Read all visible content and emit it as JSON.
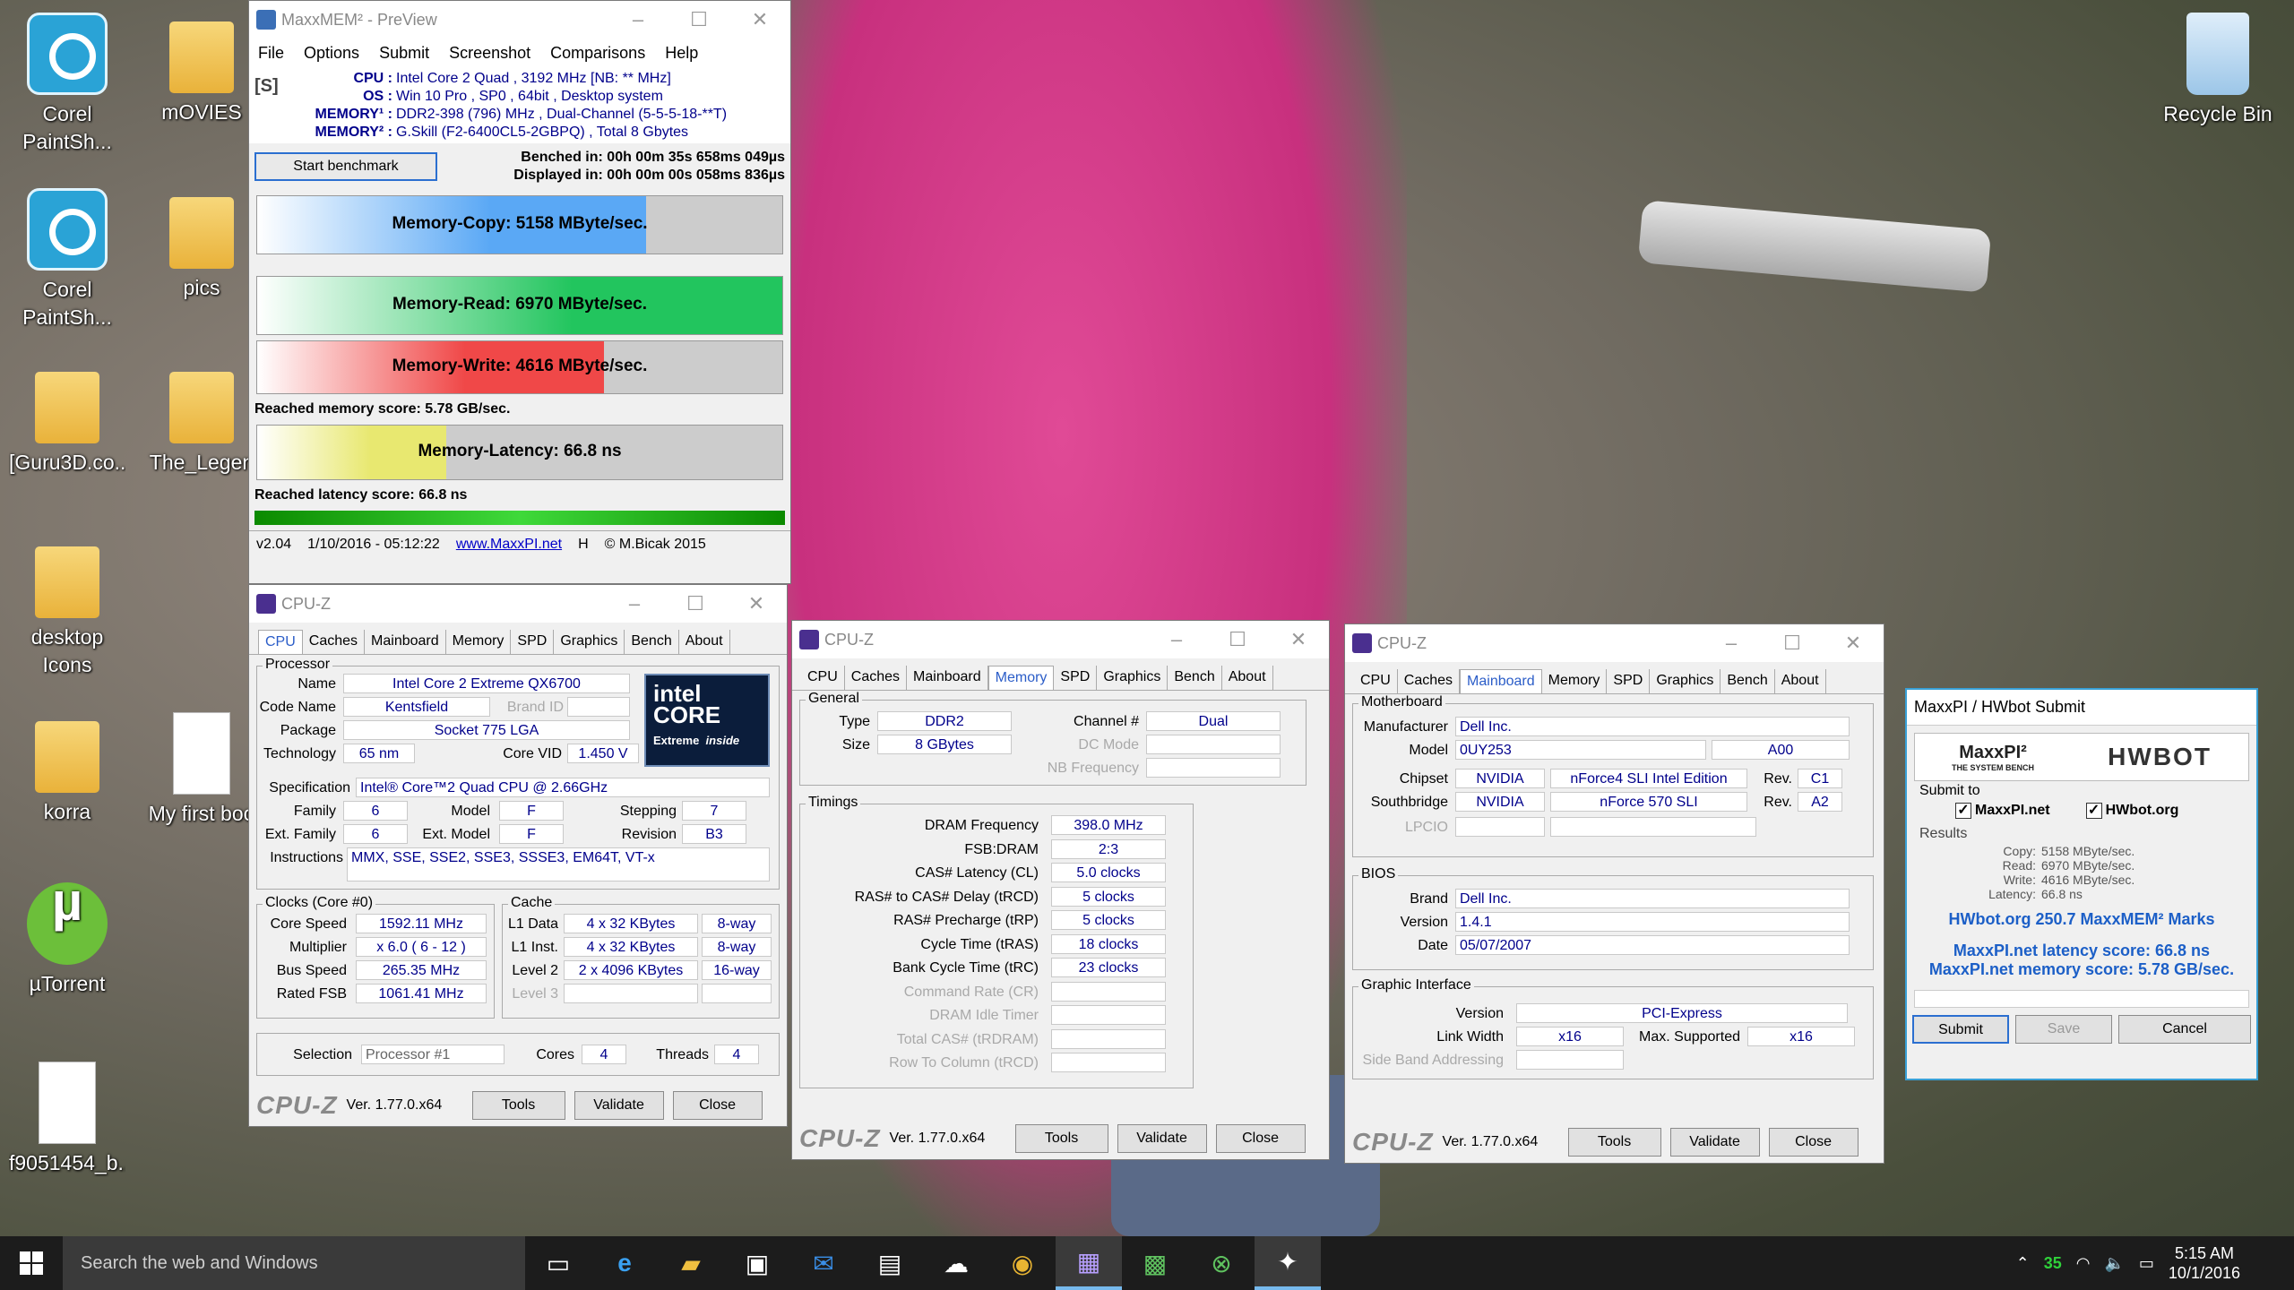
{
  "desktop": {
    "icons": [
      {
        "label1": "Corel",
        "label2": "PaintSh..."
      },
      {
        "label1": "mOVIES",
        "label2": ""
      },
      {
        "label1": "Corel",
        "label2": "PaintSh..."
      },
      {
        "label1": "pics",
        "label2": ""
      },
      {
        "label1": "[Guru3D.co...",
        "label2": ""
      },
      {
        "label1": "The_Legen",
        "label2": ""
      },
      {
        "label1": "desktop",
        "label2": "Icons"
      },
      {
        "label1": "korra",
        "label2": ""
      },
      {
        "label1": "My first boo",
        "label2": ""
      },
      {
        "label1": "µTorrent",
        "label2": ""
      },
      {
        "label1": "f9051454_b...",
        "label2": ""
      },
      {
        "label1": "Recycle Bin",
        "label2": ""
      }
    ]
  },
  "maxxmem": {
    "title": "MaxxMEM² - PreView",
    "menu": [
      "File",
      "Options",
      "Submit",
      "Screenshot",
      "Comparisons",
      "Help"
    ],
    "s_tag": "[S]",
    "info": [
      {
        "k": "CPU :",
        "v": "Intel Core 2 Quad , 3192 MHz  [NB: ** MHz]"
      },
      {
        "k": "OS :",
        "v": "Win 10 Pro , SP0 , 64bit , Desktop system"
      },
      {
        "k": "MEMORY¹ :",
        "v": "DDR2-398 (796) MHz , Dual-Channel (5-5-5-18-**T)"
      },
      {
        "k": "MEMORY² :",
        "v": "G.Skill (F2-6400CL5-2GBPQ) , Total 8 Gbytes"
      }
    ],
    "start_button": "Start benchmark",
    "benched": "Benched in: 00h 00m 35s 658ms 049µs",
    "displayed": "Displayed in: 00h 00m 00s 058ms 836µs",
    "copy": {
      "label": "Memory-Copy: 5158 MByte/sec.",
      "fill": 0.74,
      "color": "#5aa8f5"
    },
    "read": {
      "label": "Memory-Read: 6970 MByte/sec.",
      "fill": 1.0,
      "color": "#22c55e"
    },
    "write": {
      "label": "Memory-Write: 4616 MByte/sec.",
      "fill": 0.66,
      "color": "#f04848"
    },
    "memory_score": "Reached memory score: 5.78 GB/sec.",
    "latency": {
      "label": "Memory-Latency: 66.8 ns",
      "fill": 0.36,
      "color": "#e8e870"
    },
    "latency_score": "Reached latency score: 66.8 ns",
    "status": {
      "version": "v2.04",
      "date": "1/10/2016 - 05:12:22",
      "link": "www.MaxxPI.net",
      "h": "H",
      "copyright": "© M.Bicak 2015"
    }
  },
  "cpuz1": {
    "title": "CPU-Z",
    "tabs": [
      "CPU",
      "Caches",
      "Mainboard",
      "Memory",
      "SPD",
      "Graphics",
      "Bench",
      "About"
    ],
    "processor_title": "Processor",
    "name_l": "Name",
    "name": "Intel Core 2 Extreme QX6700",
    "codename_l": "Code Name",
    "codename": "Kentsfield",
    "brandid_l": "Brand ID",
    "package_l": "Package",
    "package": "Socket 775 LGA",
    "tech_l": "Technology",
    "tech": "65 nm",
    "vid_l": "Core VID",
    "vid": "1.450 V",
    "spec_l": "Specification",
    "spec": "Intel® Core™2 Quad CPU        @ 2.66GHz",
    "family_l": "Family",
    "family": "6",
    "model_l": "Model",
    "model": "F",
    "stepping_l": "Stepping",
    "stepping": "7",
    "extfam_l": "Ext. Family",
    "extfam": "6",
    "extmodel_l": "Ext. Model",
    "extmodel": "F",
    "rev_l": "Revision",
    "rev": "B3",
    "instr_l": "Instructions",
    "instr": "MMX, SSE, SSE2, SSE3, SSSE3, EM64T, VT-x",
    "logo1": "intel",
    "logo2": "CORE",
    "logo3": "Extreme",
    "logo4": "inside",
    "clocks_title": "Clocks (Core #0)",
    "corespeed_l": "Core Speed",
    "corespeed": "1592.11 MHz",
    "mult_l": "Multiplier",
    "mult": "x 6.0 ( 6 - 12 )",
    "bus_l": "Bus Speed",
    "bus": "265.35 MHz",
    "fsb_l": "Rated FSB",
    "fsb": "1061.41 MHz",
    "cache_title": "Cache",
    "l1d_l": "L1 Data",
    "l1d": "4 x 32 KBytes",
    "l1d_w": "8-way",
    "l1i_l": "L1 Inst.",
    "l1i": "4 x 32 KBytes",
    "l1i_w": "8-way",
    "l2_l": "Level 2",
    "l2": "2 x 4096 KBytes",
    "l2_w": "16-way",
    "l3_l": "Level 3",
    "sel_l": "Selection",
    "sel": "Processor #1",
    "cores_l": "Cores",
    "cores": "4",
    "threads_l": "Threads",
    "threads": "4",
    "logo": "CPU-Z",
    "ver": "Ver. 1.77.0.x64",
    "tools": "Tools",
    "validate": "Validate",
    "close": "Close"
  },
  "cpuz2": {
    "title": "CPU-Z",
    "tabs": [
      "CPU",
      "Caches",
      "Mainboard",
      "Memory",
      "SPD",
      "Graphics",
      "Bench",
      "About"
    ],
    "general_title": "General",
    "type_l": "Type",
    "type": "DDR2",
    "channel_l": "Channel #",
    "channel": "Dual",
    "size_l": "Size",
    "size": "8 GBytes",
    "dcmode_l": "DC Mode",
    "nbfreq_l": "NB Frequency",
    "timings_title": "Timings",
    "timings": [
      {
        "k": "DRAM Frequency",
        "v": "398.0 MHz",
        "dim": false
      },
      {
        "k": "FSB:DRAM",
        "v": "2:3",
        "dim": false
      },
      {
        "k": "CAS# Latency (CL)",
        "v": "5.0 clocks",
        "dim": false
      },
      {
        "k": "RAS# to CAS# Delay (tRCD)",
        "v": "5 clocks",
        "dim": false
      },
      {
        "k": "RAS# Precharge (tRP)",
        "v": "5 clocks",
        "dim": false
      },
      {
        "k": "Cycle Time (tRAS)",
        "v": "18 clocks",
        "dim": false
      },
      {
        "k": "Bank Cycle Time (tRC)",
        "v": "23 clocks",
        "dim": false
      },
      {
        "k": "Command Rate (CR)",
        "v": "",
        "dim": true
      },
      {
        "k": "DRAM Idle Timer",
        "v": "",
        "dim": true
      },
      {
        "k": "Total CAS# (tRDRAM)",
        "v": "",
        "dim": true
      },
      {
        "k": "Row To Column (tRCD)",
        "v": "",
        "dim": true
      }
    ],
    "logo": "CPU-Z",
    "ver": "Ver. 1.77.0.x64",
    "tools": "Tools",
    "validate": "Validate",
    "close": "Close"
  },
  "cpuz3": {
    "title": "CPU-Z",
    "tabs": [
      "CPU",
      "Caches",
      "Mainboard",
      "Memory",
      "SPD",
      "Graphics",
      "Bench",
      "About"
    ],
    "mb_title": "Motherboard",
    "manu_l": "Manufacturer",
    "manu": "Dell Inc.",
    "model_l": "Model",
    "model": "0UY253",
    "model_rev": "A00",
    "chipset_l": "Chipset",
    "chipset_v": "NVIDIA",
    "chipset_n": "nForce4 SLI Intel Edition",
    "rev_l": "Rev.",
    "chipset_rev": "C1",
    "sb_l": "Southbridge",
    "sb_v": "NVIDIA",
    "sb_n": "nForce 570 SLI",
    "sb_rev": "A2",
    "lpcio_l": "LPCIO",
    "bios_title": "BIOS",
    "brand_l": "Brand",
    "brand": "Dell Inc.",
    "version_l": "Version",
    "version": "1.4.1",
    "date_l": "Date",
    "date": "05/07/2007",
    "gi_title": "Graphic Interface",
    "giver_l": "Version",
    "giver": "PCI-Express",
    "lw_l": "Link Width",
    "lw": "x16",
    "maxsup_l": "Max. Supported",
    "maxsup": "x16",
    "sba_l": "Side Band Addressing",
    "logo": "CPU-Z",
    "ver": "Ver. 1.77.0.x64",
    "tools": "Tools",
    "validate": "Validate",
    "close": "Close"
  },
  "submit": {
    "title": "MaxxPI / HWbot Submit",
    "maxxpi_logo": "MaxxPI²",
    "maxxpi_sub": "THE SYSTEM BENCH",
    "hwbot_logo": "HWBOT",
    "submit_to": "Submit to",
    "opt1": "MaxxPI.net",
    "opt2": "HWbot.org",
    "results_l": "Results",
    "results": [
      {
        "k": "Copy:",
        "v": "5158 MByte/sec."
      },
      {
        "k": "Read:",
        "v": "6970 MByte/sec."
      },
      {
        "k": "Write:",
        "v": "4616 MByte/sec."
      },
      {
        "k": "Latency:",
        "v": "66.8 ns"
      }
    ],
    "marks": "HWbot.org  250.7  MaxxMEM² Marks",
    "lat_score": "MaxxPI.net latency score:  66.8  ns",
    "mem_score": "MaxxPI.net memory score:  5.78  GB/sec.",
    "submit_btn": "Submit",
    "save_btn": "Save",
    "cancel_btn": "Cancel"
  },
  "taskbar": {
    "search_placeholder": "Search the web and Windows",
    "tray_badge": "35",
    "time": "5:15 AM",
    "date": "10/1/2016"
  }
}
